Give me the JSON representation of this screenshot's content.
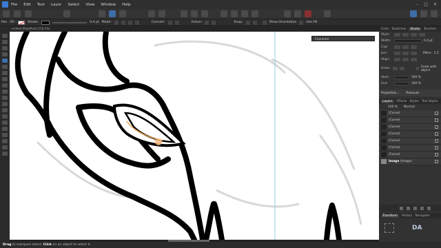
{
  "menu": [
    "File",
    "Edit",
    "Text",
    "Layer",
    "Select",
    "View",
    "Window",
    "Help"
  ],
  "context": {
    "tool": "Pen",
    "fill_label": "Fill:",
    "stroke_label": "Stroke:",
    "stroke_width": "0.4 pt",
    "mode_label": "Mode:",
    "convert_label": "Convert:",
    "action_label": "Action:",
    "snap_label": "Snap:",
    "show_orientation": "Show Orientation",
    "use_fill": "Use Fill"
  },
  "document_tab": "untitled [Modified] (150.1%)",
  "character_panel": "Character",
  "right_panel": {
    "top_tabs": [
      "Color",
      "Swatches",
      "Stroke",
      "Brushes"
    ],
    "active_top_tab": "Stroke",
    "style_label": "Style:",
    "width_label": "Width:",
    "width_value": "0.4 pt",
    "cap_label": "Cap:",
    "join_label": "Join:",
    "mitre_label": "Mitre:",
    "mitre_value": "1.5",
    "align_label": "Align:",
    "order_label": "Order:",
    "scale_with_object": "Scale with object",
    "start_label": "Start:",
    "end_label": "End:",
    "start_pct": "100 %",
    "end_pct": "100 %",
    "properties": "Properties...",
    "pressure": "Pressure",
    "layer_tabs": [
      "Layers",
      "Effects",
      "Styles",
      "Text Styles"
    ],
    "opacity": "100 %",
    "blend": "Normal",
    "layers": [
      "(Curve)",
      "(Curve)",
      "(Curve)",
      "(Curve)",
      "(Curve)",
      "(Curve)",
      "(Curve)"
    ],
    "image_layer_name": "Image",
    "image_layer_type": "(Image)",
    "bottom_tabs": [
      "Transform",
      "History",
      "Navigator"
    ],
    "da_label": "DA"
  },
  "status": {
    "drag": "Drag",
    "drag_text": "to marquee select.",
    "click": "Click",
    "click_text": "on an object to select it."
  }
}
